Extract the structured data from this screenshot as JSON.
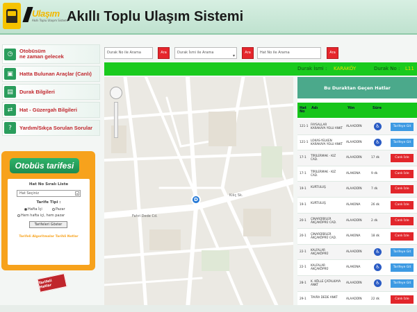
{
  "header": {
    "brand": "Ulaşım",
    "brand_tagline": "Akıllı Toplu Ulaşım Sistemi",
    "title": "Akıllı Toplu Ulaşım Sistemi"
  },
  "nav": {
    "items": [
      {
        "label_line1": "Otobüsüm",
        "label_line2": "ne zaman gelecek",
        "icon": "clock-icon"
      },
      {
        "label_line1": "Hatta Bulunan Araçlar (Canlı)",
        "label_line2": "",
        "icon": "bus-icon"
      },
      {
        "label_line1": "Durak Bilgileri",
        "label_line2": "",
        "icon": "stop-icon"
      },
      {
        "label_line1": "Hat - Güzergah Bilgileri",
        "label_line2": "",
        "icon": "route-icon"
      },
      {
        "label_line1": "Yardım/Sıkça Sorulan Sorular",
        "label_line2": "",
        "icon": "help-icon"
      }
    ]
  },
  "tariff": {
    "title": "Otobüs tarifesi",
    "list_label": "Hat No Sıralı Liste",
    "select_value": "Hat Seçiniz",
    "type_label": "Tarife Tipi :",
    "radio_weekday": "Hafta İçi",
    "radio_sunday": "Pazar",
    "radio_both": "Hem hafta içi, hem pazar",
    "button_label": "Tarifeleri Göster",
    "link_text": "Tarifeli Algoritmalar Tarihli Notlar",
    "stamp_text": "Tarifeli Hatlar"
  },
  "search": {
    "stop_placeholder": "Durak No ile Arama",
    "line_placeholder": "Durak İsmi ile Arama",
    "route_placeholder": "Hat No ile Arama",
    "button_label": "Ara"
  },
  "info": {
    "stop_name_label": "Durak İsmi :",
    "stop_name_value": "KARAKÖY",
    "stop_no_label": "Durak No :",
    "stop_no_value": "L11"
  },
  "panel": {
    "title": "Bu Duraktan Geçen Hatlar",
    "col_line": "Hat No",
    "col_name": "Adı",
    "col_dir": "Yön",
    "col_min": "Süre",
    "rows": [
      {
        "no": "121-1",
        "name": "FAYSALLAR KARAKAYA YOLU ANKT",
        "dir": "ALAADDİN",
        "min": "",
        "accessible": true,
        "action": "Tarifeye Git",
        "action_type": "blue"
      },
      {
        "no": "121-1",
        "name": "LOKAS-YELKEN KARAKAYA YOLU ANKT",
        "dir": "ALAADDİN",
        "min": "",
        "accessible": true,
        "action": "Tarifeye Git",
        "action_type": "blue"
      },
      {
        "no": "17-1",
        "name": "TİRİLERMAK - KIZ CAD.",
        "dir": "ALAADDİN",
        "min": "17 dk",
        "accessible": false,
        "action": "Canlı İzle",
        "action_type": "red"
      },
      {
        "no": "17-1",
        "name": "TİRİLERMAK - KIZ CAD.",
        "dir": "ALAKONA",
        "min": "9 dk",
        "accessible": false,
        "action": "Canlı İzle",
        "action_type": "red"
      },
      {
        "no": "19-1",
        "name": "KURTULUŞ",
        "dir": "ALAADDİN",
        "min": "7 dk",
        "accessible": false,
        "action": "Canlı İzle",
        "action_type": "red"
      },
      {
        "no": "19-1",
        "name": "KURTULUŞ",
        "dir": "ALAKONA",
        "min": "26 dk",
        "accessible": false,
        "action": "Canlı İzle",
        "action_type": "red"
      },
      {
        "no": "20-1",
        "name": "ÇINARDİBİLER AKÇAKÖPRÜ CAD.",
        "dir": "ALAADDİN",
        "min": "2 dk",
        "accessible": false,
        "action": "Canlı İzle",
        "action_type": "red"
      },
      {
        "no": "20-1",
        "name": "ÇINARDİBİLER AKÇAKÖPRÜ CAD.",
        "dir": "ALAKONA",
        "min": "18 dk",
        "accessible": false,
        "action": "Canlı İzle",
        "action_type": "red"
      },
      {
        "no": "22-1",
        "name": "KALFALAR AKÇAKÖPRÜ",
        "dir": "ALAADDİN",
        "min": "",
        "accessible": true,
        "action": "Tarifeye Git",
        "action_type": "blue"
      },
      {
        "no": "22-1",
        "name": "KALFALAR AKÇAKÖPRÜ",
        "dir": "ALAKONA",
        "min": "",
        "accessible": true,
        "action": "Tarifeye Git",
        "action_type": "blue"
      },
      {
        "no": "28-1",
        "name": "K. KÖLLE ÇATALKAYA ANKT",
        "dir": "ALAADDİN",
        "min": "",
        "accessible": true,
        "action": "Tarifeye Git",
        "action_type": "blue"
      },
      {
        "no": "29-1",
        "name": "TAVRA DEDE ANKT",
        "dir": "ALAADDİN",
        "min": "22 dk",
        "accessible": false,
        "action": "Canlı İzle",
        "action_type": "red"
      }
    ]
  },
  "map": {
    "street_main": "Fahri Dede Cd.",
    "street_2": "Kılıç Sk.",
    "marker_symbol": "D"
  },
  "colors": {
    "green_bar": "#1aca1e",
    "red": "#e2262b",
    "blue": "#3d9ae3",
    "orange": "#f7a21c",
    "panel_head": "#4ba98b"
  }
}
